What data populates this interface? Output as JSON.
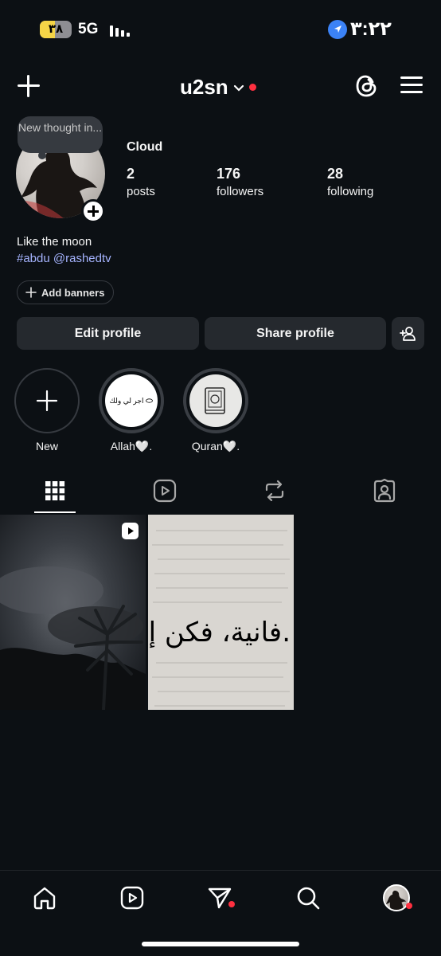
{
  "status_bar": {
    "battery": "٣٨",
    "network": "5G",
    "time": "٣:٢٢"
  },
  "header": {
    "username": "u2sn"
  },
  "note": {
    "text": "New thought in..."
  },
  "profile": {
    "name": "Cloud",
    "stats": [
      {
        "value": "2",
        "label": "posts"
      },
      {
        "value": "176",
        "label": "followers"
      },
      {
        "value": "28",
        "label": "following"
      }
    ],
    "bio": "Like the moon",
    "bio_links": "#abdu @rashedtv",
    "add_banners": "Add banners"
  },
  "buttons": {
    "edit": "Edit profile",
    "share": "Share profile"
  },
  "highlights": [
    {
      "label": "New",
      "inner_text": ""
    },
    {
      "label": "Allah🤍.",
      "inner_text": "اجر لي ولك"
    },
    {
      "label": "Quran🤍.",
      "inner_text": ""
    }
  ],
  "grid": {
    "post2_text": "فانية، فكن إنسان."
  },
  "colors": {
    "background": "#0c1014",
    "accent_link": "#a6b4ff",
    "notification": "#ff3040",
    "button": "#25292e"
  }
}
